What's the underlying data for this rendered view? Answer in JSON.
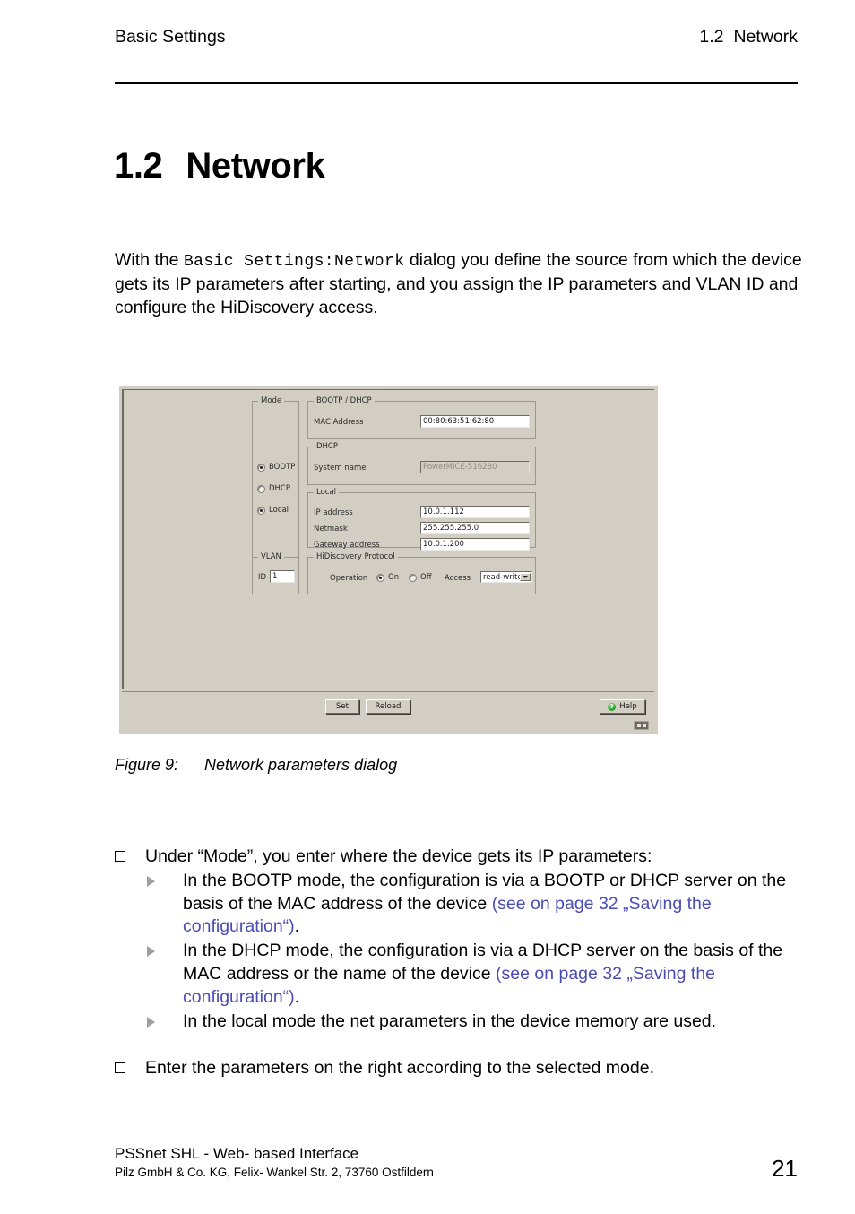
{
  "header": {
    "left": "Basic Settings",
    "right_number": "1.2",
    "right_title": "Network"
  },
  "chapter": {
    "number": "1.2",
    "title": "Network"
  },
  "intro": {
    "part1": "With the ",
    "dialog_path": "Basic Settings:Network",
    "part2": " dialog you define the source from which the device gets its IP parameters after starting, and you assign the IP parameters and VLAN ID and configure the HiDiscovery access."
  },
  "dialog": {
    "mode": {
      "legend": "Mode",
      "options": [
        {
          "label": "BOOTP",
          "selected": false
        },
        {
          "label": "DHCP",
          "selected": false
        },
        {
          "label": "Local",
          "selected": true
        }
      ]
    },
    "bootp_dhcp": {
      "legend": "BOOTP / DHCP",
      "mac_label": "MAC Address",
      "mac_value": "00:80:63:51:62:80"
    },
    "dhcp": {
      "legend": "DHCP",
      "system_name_label": "System name",
      "system_name_value": "PowerMICE-516280"
    },
    "local": {
      "legend": "Local",
      "ip_label": "IP address",
      "ip_value": "10.0.1.112",
      "netmask_label": "Netmask",
      "netmask_value": "255.255.255.0",
      "gateway_label": "Gateway address",
      "gateway_value": "10.0.1.200"
    },
    "vlan": {
      "legend": "VLAN",
      "id_label": "ID",
      "id_value": "1"
    },
    "hidiscovery": {
      "legend": "HiDiscovery Protocol",
      "operation_label": "Operation",
      "on_label": "On",
      "off_label": "Off",
      "on_selected": true,
      "off_selected": false,
      "access_label": "Access",
      "access_value": "read-write"
    },
    "buttons": {
      "set": "Set",
      "reload": "Reload",
      "help": "Help",
      "help_glyph": "?"
    }
  },
  "caption": {
    "label": "Figure 9:",
    "text": "Network parameters dialog"
  },
  "body": {
    "bullet1": "Under “Mode”, you enter where the device gets its IP parameters:",
    "sub1_a": "In the BOOTP mode, the configuration is via a BOOTP or DHCP server on the basis of the MAC address of the device ",
    "sub1_link": "(see on page 32 „Saving the configuration“)",
    "sub1_end": ".",
    "sub2_a": "In the DHCP mode, the configuration is via a DHCP server on the basis of the MAC address or the name of the device ",
    "sub2_link": "(see on page 32 „Saving the configuration“)",
    "sub2_end": ".",
    "sub3": "In the local mode the net parameters in the device memory are used.",
    "bullet2": "Enter the parameters on the right according to the selected mode."
  },
  "footer": {
    "line1": "PSSnet SHL - Web- based Interface",
    "line2": "Pilz GmbH & Co. KG, Felix- Wankel Str. 2, 73760 Ostfildern",
    "page": "21"
  },
  "colors": {
    "xref": "#4b4bb5",
    "dialog_bg": "#d2cec4",
    "help_icon": "#1f9b1f"
  }
}
